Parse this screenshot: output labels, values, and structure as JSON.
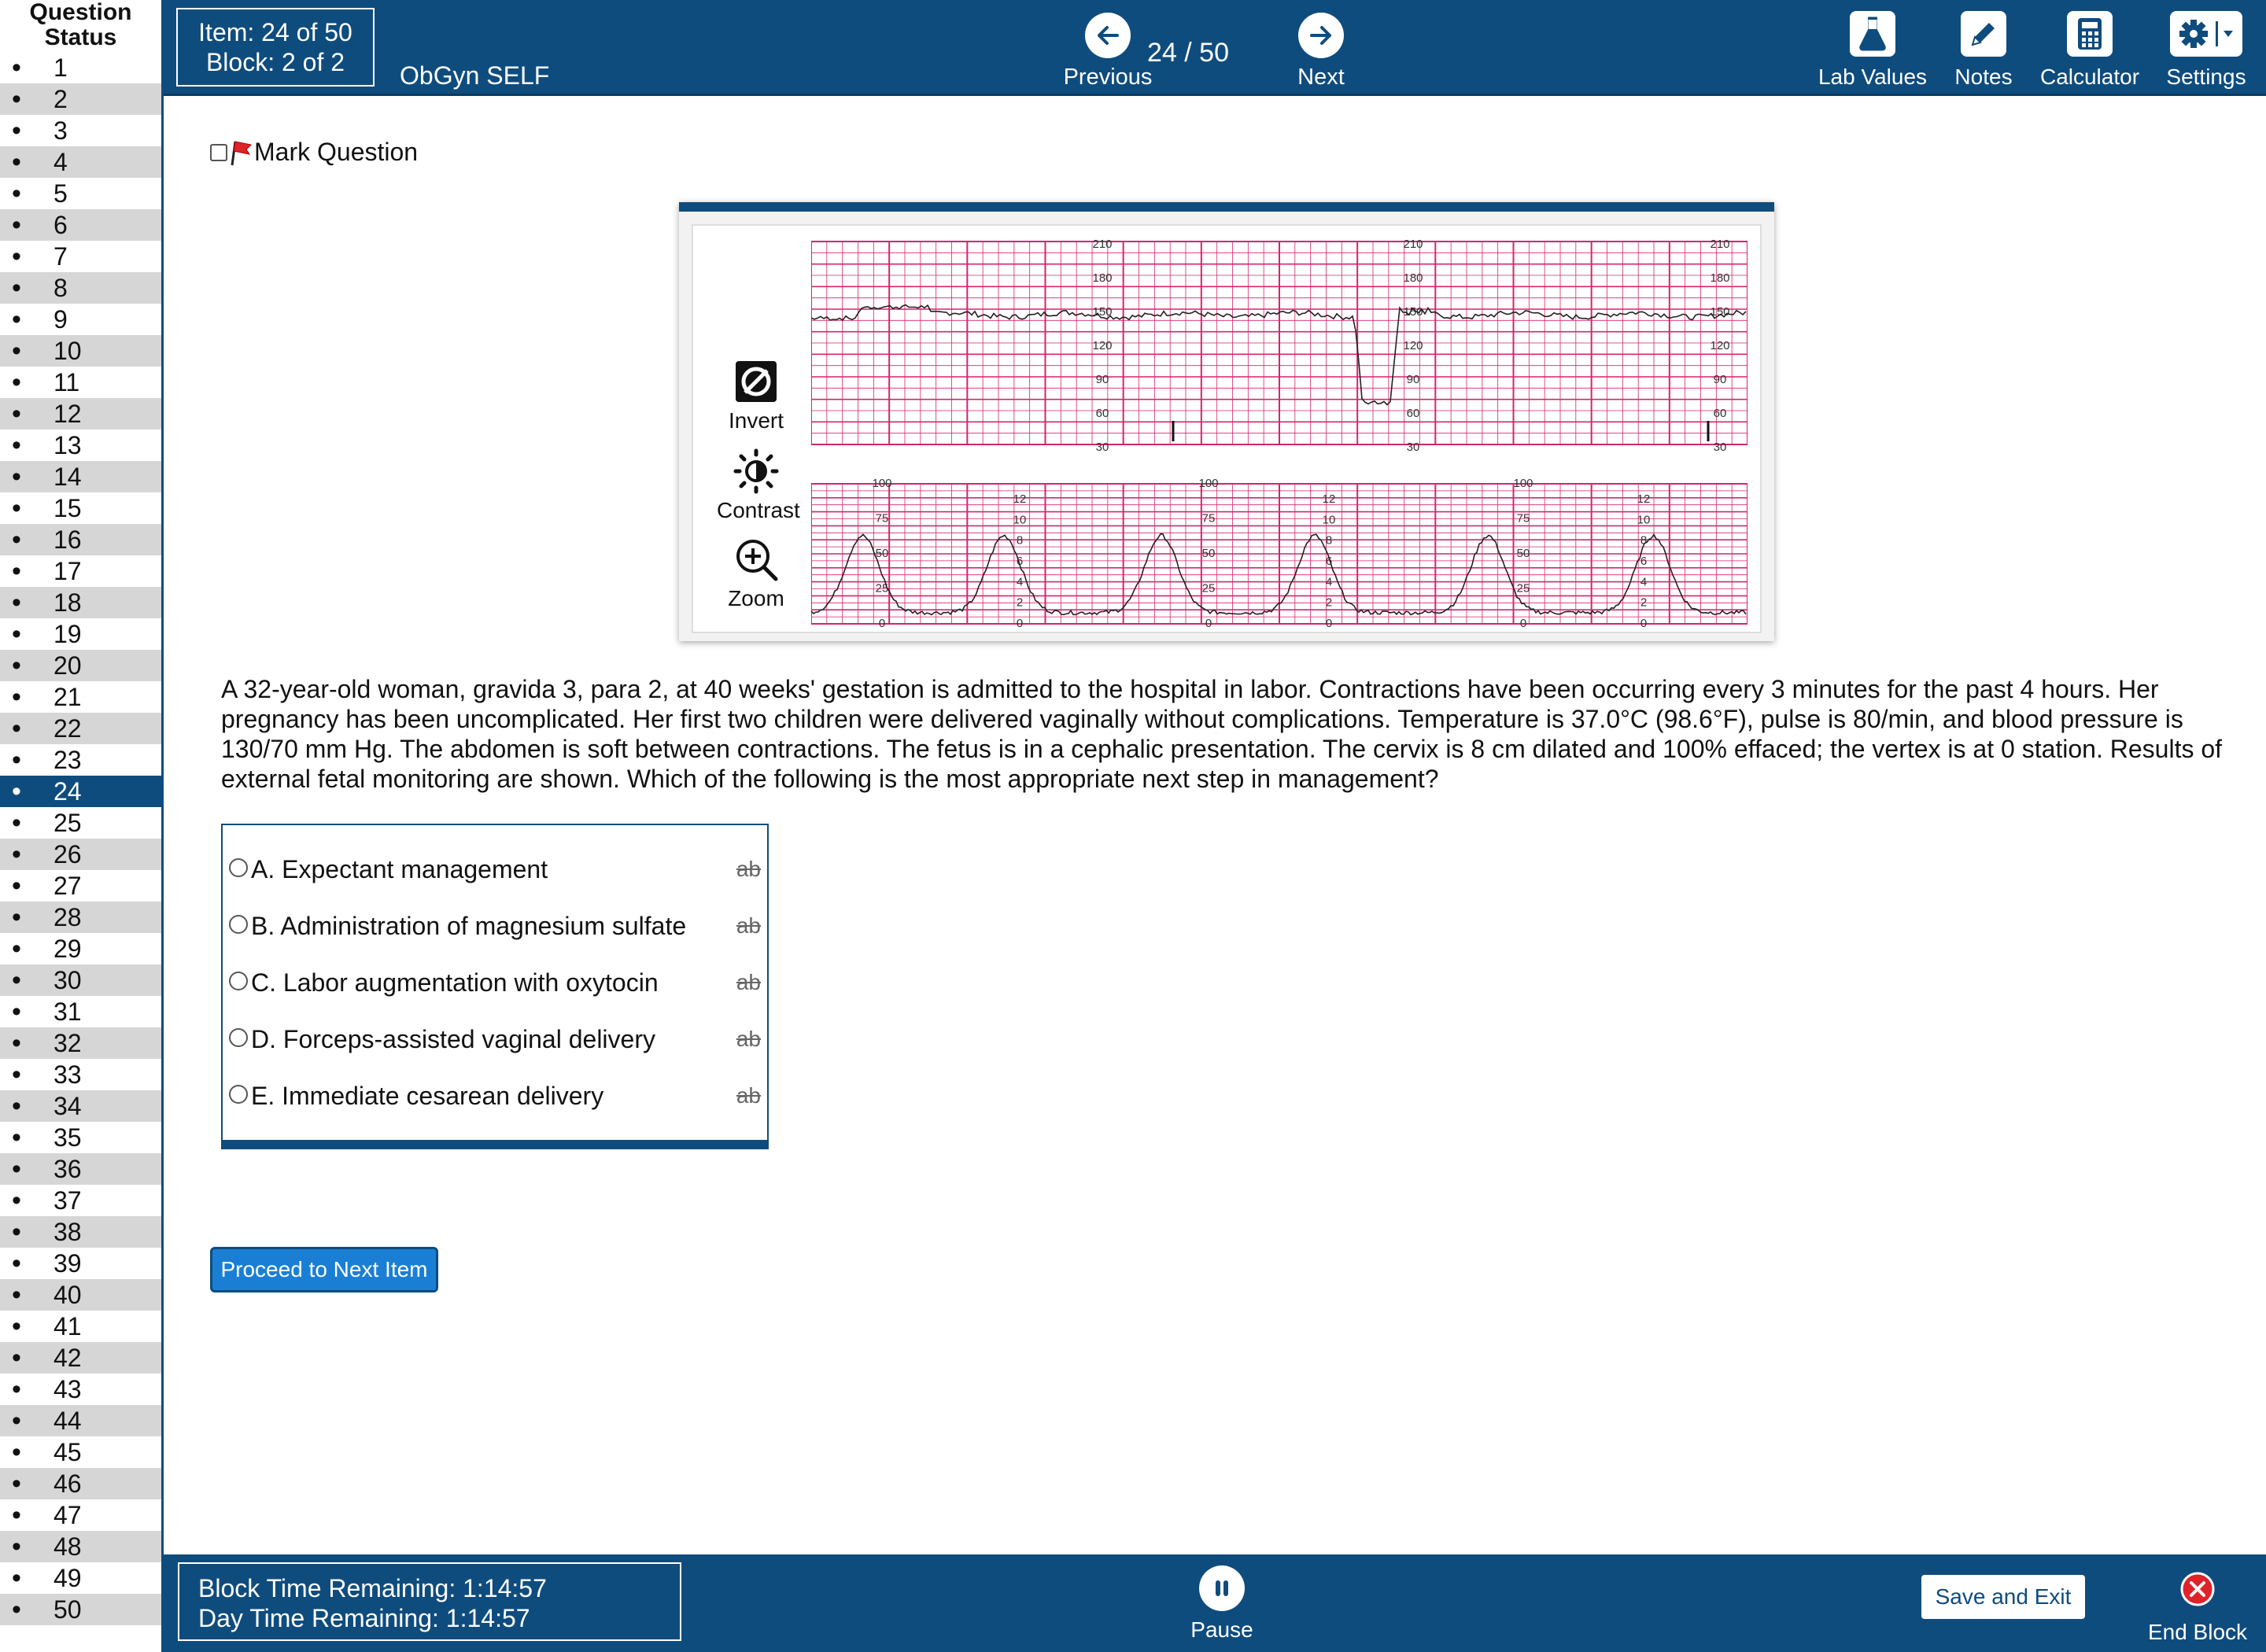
{
  "sidebar": {
    "title_line1": "Question",
    "title_line2": "Status",
    "current": 24,
    "questions": [
      "1",
      "2",
      "3",
      "4",
      "5",
      "6",
      "7",
      "8",
      "9",
      "10",
      "11",
      "12",
      "13",
      "14",
      "15",
      "16",
      "17",
      "18",
      "19",
      "20",
      "21",
      "22",
      "23",
      "24",
      "25",
      "26",
      "27",
      "28",
      "29",
      "30",
      "31",
      "32",
      "33",
      "34",
      "35",
      "36",
      "37",
      "38",
      "39",
      "40",
      "41",
      "42",
      "43",
      "44",
      "45",
      "46",
      "47",
      "48",
      "49",
      "50"
    ]
  },
  "header": {
    "item_label": "Item: 24 of 50",
    "block_label": "Block: 2 of 2",
    "exam_title": "ObGyn SELF",
    "previous_label": "Previous",
    "next_label": "Next",
    "counter": "24 / 50",
    "tools": {
      "lab_values": "Lab Values",
      "notes": "Notes",
      "calculator": "Calculator",
      "settings": "Settings"
    }
  },
  "main": {
    "mark_label": "Mark Question",
    "exhibit": {
      "invert_label": "Invert",
      "contrast_label": "Contrast",
      "zoom_label": "Zoom",
      "fhr_scale": [
        "210",
        "180",
        "150",
        "120",
        "90",
        "60",
        "30"
      ],
      "toco_scale": [
        "100",
        "75",
        "50",
        "25",
        "0"
      ],
      "toco_scale_kpa": [
        "12",
        "10",
        "8",
        "6",
        "4",
        "2",
        "0"
      ]
    },
    "stem": "A 32-year-old woman, gravida 3, para 2, at 40 weeks' gestation is admitted to the hospital in labor. Contractions have been occurring every 3 minutes for the past 4 hours. Her pregnancy has been uncomplicated. Her first two children were delivered vaginally without complications. Temperature is 37.0°C (98.6°F), pulse is 80/min, and blood pressure is 130/70 mm Hg. The abdomen is soft between contractions. The fetus is in a cephalic presentation. The cervix is 8 cm dilated and 100% effaced; the vertex is at 0 station. Results of external fetal monitoring are shown. Which of the following is the most appropriate next step in management?",
    "answers": [
      {
        "text": "A. Expectant management",
        "strike": "ab"
      },
      {
        "text": "B. Administration of magnesium sulfate",
        "strike": "ab"
      },
      {
        "text": "C. Labor augmentation with oxytocin",
        "strike": "ab"
      },
      {
        "text": "D. Forceps-assisted vaginal delivery",
        "strike": "ab"
      },
      {
        "text": "E. Immediate cesarean delivery",
        "strike": "ab"
      }
    ],
    "proceed_label": "Proceed to Next Item"
  },
  "footer": {
    "block_time": "Block Time Remaining: 1:14:57",
    "day_time": "Day Time Remaining: 1:14:57",
    "pause_label": "Pause",
    "save_exit_label": "Save and Exit",
    "end_block_label": "End Block"
  },
  "colors": {
    "brand_blue": "#0f4c7e",
    "button_blue": "#1a7fd4",
    "grid_pink": "#d6246e",
    "end_red": "#e0222a"
  }
}
